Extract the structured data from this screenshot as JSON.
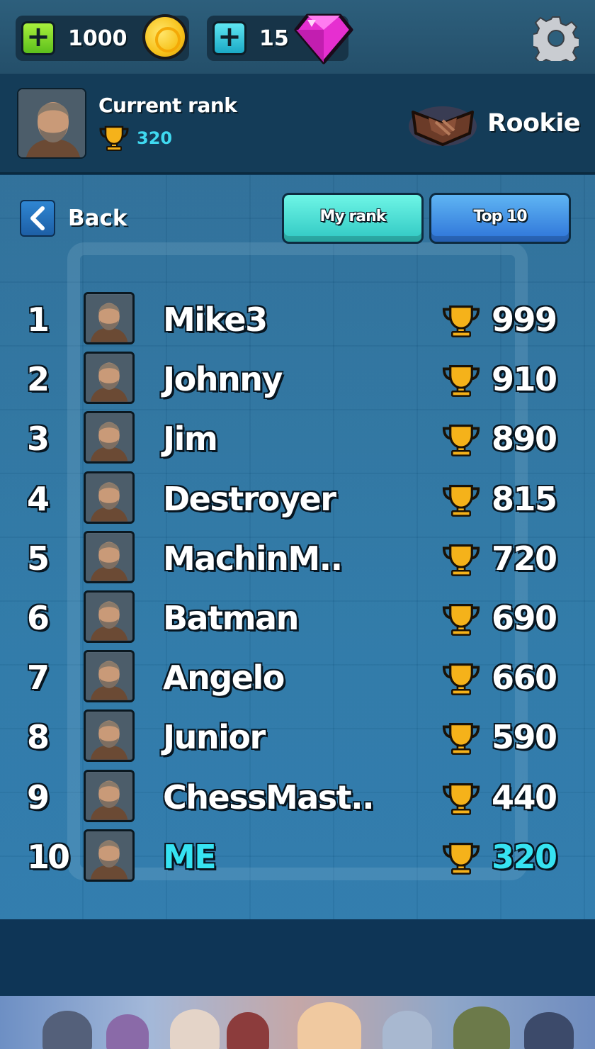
{
  "currency": {
    "coins": "1000",
    "gems": "15",
    "add_coins_icon": "plus-icon",
    "add_gems_icon": "plus-icon",
    "coin_icon": "gold-coin-icon",
    "gem_icon": "pink-gem-icon"
  },
  "settings": {
    "icon": "gear-icon"
  },
  "current_rank": {
    "title": "Current rank",
    "trophies": "320",
    "rank_name": "Rookie",
    "badge_icon": "rookie-badge-icon"
  },
  "nav": {
    "back_label": "Back",
    "tabs": [
      {
        "label": "My rank"
      },
      {
        "label": "Top 10"
      }
    ]
  },
  "leaderboard": [
    {
      "rank": "1",
      "name": "Mike3",
      "score": "999"
    },
    {
      "rank": "2",
      "name": "Johnny",
      "score": "910"
    },
    {
      "rank": "3",
      "name": "Jim",
      "score": "890"
    },
    {
      "rank": "4",
      "name": "Destroyer",
      "score": "815"
    },
    {
      "rank": "5",
      "name": "MachinM..",
      "score": "720"
    },
    {
      "rank": "6",
      "name": "Batman",
      "score": "690"
    },
    {
      "rank": "7",
      "name": "Angelo",
      "score": "660"
    },
    {
      "rank": "8",
      "name": "Junior",
      "score": "590"
    },
    {
      "rank": "9",
      "name": "ChessMast..",
      "score": "440"
    },
    {
      "rank": "10",
      "name": "ME",
      "score": "320",
      "is_me": true
    }
  ],
  "colors": {
    "highlight": "#36e3f2",
    "tab_my_rank": "#4ee0d6",
    "tab_top10": "#3d8ee6",
    "trophy": "#f5b21a"
  }
}
